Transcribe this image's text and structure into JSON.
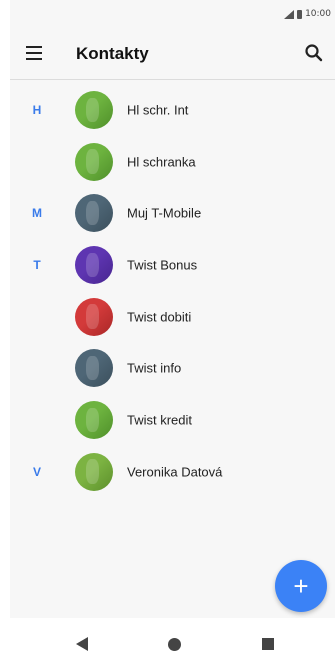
{
  "status_bar": {
    "time": "10:00",
    "icons": [
      "signal-icon",
      "battery-icon"
    ]
  },
  "app_bar": {
    "title": "Kontakty",
    "menu_icon": "menu-icon",
    "search_icon": "search-icon"
  },
  "contacts": [
    {
      "letter": "H",
      "name": "Hl schr. Int",
      "avatar_color": "#6db33f",
      "avatar_color_dark": "#4f8f2a"
    },
    {
      "letter": "",
      "name": "Hl schranka",
      "avatar_color": "#6db33f",
      "avatar_color_dark": "#4f8f2a"
    },
    {
      "letter": "M",
      "name": "Muj T-Mobile",
      "avatar_color": "#4e6676",
      "avatar_color_dark": "#3b4f5c"
    },
    {
      "letter": "T",
      "name": "Twist Bonus",
      "avatar_color": "#5e35b1",
      "avatar_color_dark": "#47258f"
    },
    {
      "letter": "",
      "name": "Twist dobiti",
      "avatar_color": "#d33a3a",
      "avatar_color_dark": "#a82727"
    },
    {
      "letter": "",
      "name": "Twist info",
      "avatar_color": "#4e6676",
      "avatar_color_dark": "#3b4f5c"
    },
    {
      "letter": "",
      "name": "Twist kredit",
      "avatar_color": "#6db33f",
      "avatar_color_dark": "#4f8f2a"
    },
    {
      "letter": "V",
      "name": "Veronika Datová",
      "avatar_color": "#7cb342",
      "avatar_color_dark": "#5c8f2b"
    }
  ],
  "fab": {
    "label": "+",
    "icon": "add-icon",
    "color": "#3b82f6"
  },
  "nav_bar": {
    "icons": [
      "back-icon",
      "home-icon",
      "recents-icon"
    ]
  },
  "colors": {
    "accent": "#3a7bea",
    "background": "#f7f7f7"
  }
}
